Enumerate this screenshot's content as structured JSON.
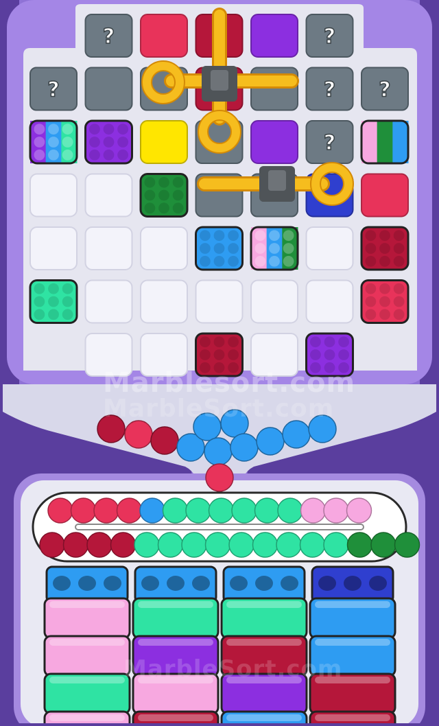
{
  "colors": {
    "background": "#5a3e9e",
    "board_frame": "#a486e6",
    "board_inner": "#e6e6f0",
    "empty_slot": "#f3f3fa",
    "hidden": "#6d7a84",
    "red": "#e8335a",
    "crimson": "#b5173a",
    "purple": "#8c2fe0",
    "yellow": "#ffe600",
    "green": "#1f8f3a",
    "blue": "#2e9cf2",
    "teal": "#2fe3a3",
    "pink": "#f7a8e0",
    "navy": "#2f3fcf",
    "pin": "#f6bd1e",
    "pin_dark": "#d48a06"
  },
  "board": {
    "hidden_symbol": "?",
    "hidden_count": 7,
    "rows": [
      [
        null,
        "hidden",
        "red-plain",
        "crimson-plain",
        "purple-plain",
        "hidden",
        null
      ],
      [
        "hidden",
        "gray-plain",
        "gray-plain",
        "crimson-plain",
        "gray-plain",
        "hidden",
        "hidden"
      ],
      [
        "multi-purple-blue-teal",
        "purple-box",
        "yellow-plain",
        "gray-plain",
        "purple-plain",
        "hidden",
        "multi-pink-green-blue"
      ],
      [
        "empty",
        "empty",
        "green-box",
        "gray-plain",
        "gray-plain",
        "navy-plain",
        "red-plain"
      ],
      [
        "empty",
        "empty",
        "empty",
        "blue-box",
        "multi-pink-blue-green",
        "empty",
        "crimson-box"
      ],
      [
        "teal-box",
        "empty",
        "empty",
        "empty",
        "empty",
        "empty",
        "red-box"
      ],
      [
        null,
        "empty",
        "empty",
        "crimson-box",
        "empty",
        "purple-box",
        null
      ]
    ]
  },
  "pins": [
    {
      "name": "pin-vertical-top",
      "orientation": "vertical"
    },
    {
      "name": "pin-left-ring",
      "orientation": "horizontal"
    },
    {
      "name": "pin-down-ring",
      "orientation": "vertical"
    },
    {
      "name": "pin-right-ring",
      "orientation": "horizontal"
    }
  ],
  "hopper_marbles": [
    "crimson",
    "red",
    "crimson",
    "blue",
    "blue",
    "blue",
    "blue",
    "blue",
    "blue",
    "blue",
    "blue",
    "red"
  ],
  "conveyor": {
    "top_row": [
      "red",
      "red",
      "red",
      "red",
      "blue",
      "teal",
      "teal",
      "teal",
      "teal",
      "teal",
      "teal",
      "pink",
      "pink",
      "pink"
    ],
    "bottom_row": [
      "crimson",
      "crimson",
      "crimson",
      "crimson",
      "teal",
      "teal",
      "teal",
      "teal",
      "teal",
      "teal",
      "teal",
      "teal",
      "teal",
      "green",
      "green",
      "green"
    ]
  },
  "containers": [
    {
      "color": "blue",
      "stack": [
        "pink",
        "pink",
        "teal",
        "pink"
      ]
    },
    {
      "color": "blue",
      "stack": [
        "teal",
        "purple",
        "pink",
        "crimson"
      ]
    },
    {
      "color": "blue",
      "stack": [
        "teal",
        "crimson",
        "purple",
        "blue"
      ]
    },
    {
      "color": "navy",
      "stack": [
        "blue",
        "blue",
        "crimson",
        "crimson"
      ]
    }
  ],
  "watermarks": [
    "Marblesort.com",
    "MarbleSort.com",
    "MarbleSort.com"
  ]
}
